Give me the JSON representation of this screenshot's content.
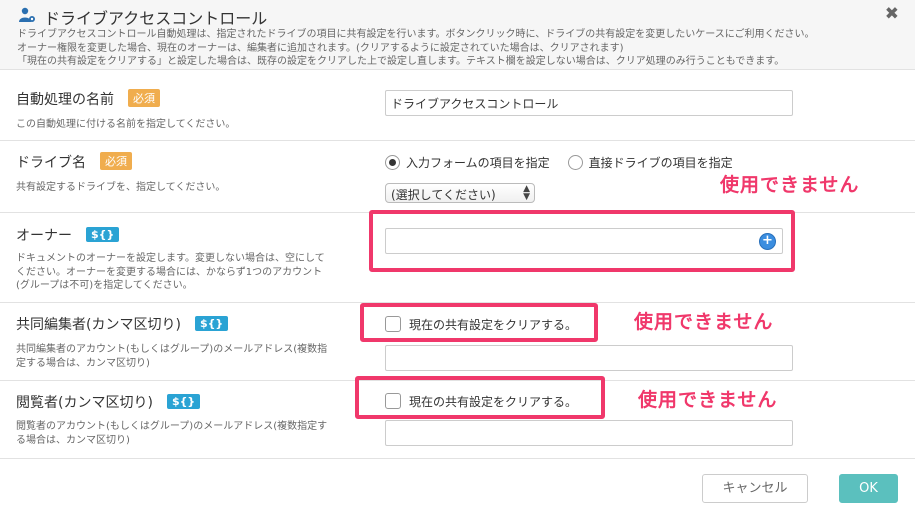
{
  "dialog": {
    "title": "ドライブアクセスコントロール",
    "close_glyph": "✖",
    "description": [
      "ドライブアクセスコントロール自動処理は、指定されたドライブの項目に共有設定を行います。ボタンクリック時に、ドライブの共有設定を変更したいケースにご利用ください。",
      "オーナー権限を変更した場合、現在のオーナーは、編集者に追加されます。(クリアするように設定されていた場合は、クリアされます)",
      "「現在の共有設定をクリアする」と設定した場合は、既存の設定をクリアした上で設定し直します。テキスト欄を設定しない場合は、クリア処理のみ行うこともできます。"
    ]
  },
  "name_field": {
    "label": "自動処理の名前",
    "badge": "必須",
    "help": "この自動処理に付ける名前を指定してください。",
    "value": "ドライブアクセスコントロール"
  },
  "drive_field": {
    "label": "ドライブ名",
    "badge": "必須",
    "help": "共有設定するドライブを、指定してください。",
    "radio_form": "入力フォームの項目を指定",
    "radio_direct": "直接ドライブの項目を指定",
    "select_value": "(選択してください)",
    "warning": "使用できません"
  },
  "owner_field": {
    "label": "オーナー",
    "badge": "${}",
    "help": [
      "ドキュメントのオーナーを設定します。変更しない場合は、空にして",
      "ください。オーナーを変更する場合には、かならず1つのアカウント",
      "(グループは不可)を指定してください。"
    ],
    "value": "",
    "plus_glyph": "+"
  },
  "editors_field": {
    "label": "共同編集者(カンマ区切り)",
    "badge": "${}",
    "help": [
      "共同編集者のアカウント(もしくはグループ)のメールアドレス(複数指",
      "定する場合は、カンマ区切り)"
    ],
    "checkbox_label": "現在の共有設定をクリアする。",
    "checked": false,
    "value": "",
    "warning": "使用できません"
  },
  "viewers_field": {
    "label": "閲覧者(カンマ区切り)",
    "badge": "${}",
    "help": [
      "閲覧者のアカウント(もしくはグループ)のメールアドレス(複数指定す",
      "る場合は、カンマ区切り)"
    ],
    "checkbox_label": "現在の共有設定をクリアする。",
    "checked": false,
    "value": "",
    "warning": "使用できません"
  },
  "footer": {
    "cancel_label": "キャンセル",
    "ok_label": "OK"
  },
  "colors": {
    "highlight": "#f0386b",
    "required_badge": "#f0ad4e",
    "variable_badge": "#2aa3d4",
    "ok_button": "#5bc0be"
  }
}
